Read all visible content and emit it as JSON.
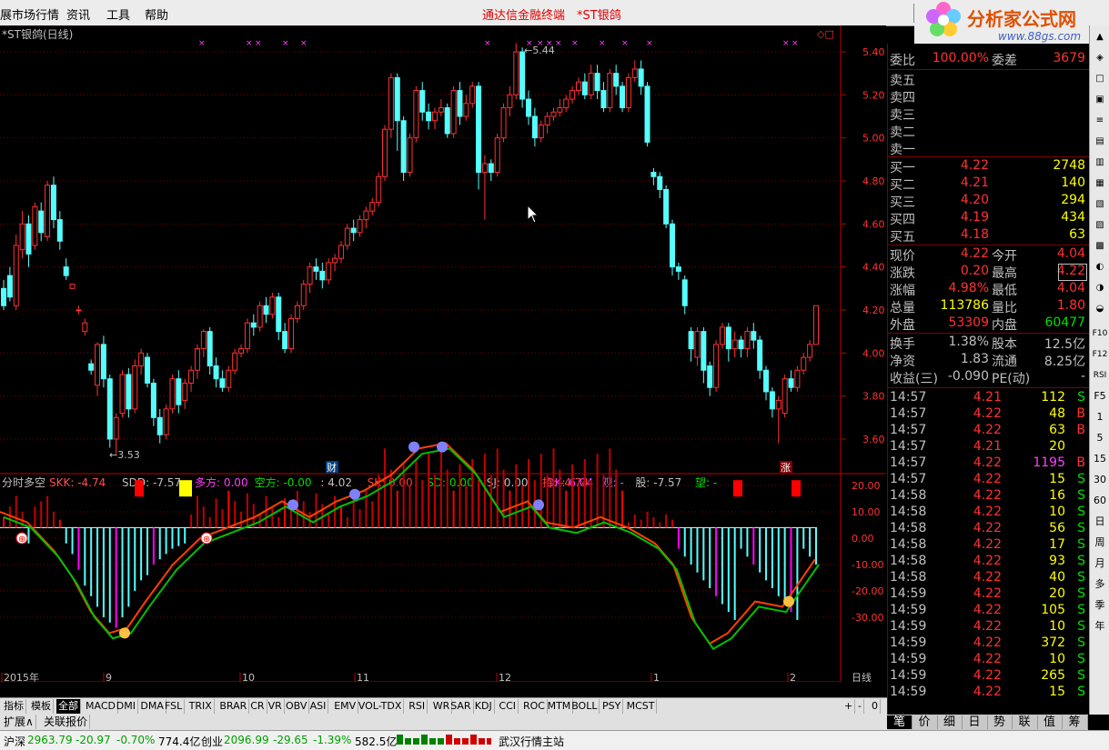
{
  "menu": {
    "items": [
      "展市场行情",
      "资讯",
      "工具",
      "帮助"
    ],
    "title": "通达信金融终端　*ST银鸽",
    "right_btn": "行"
  },
  "logo": {
    "text": "分析家公式网",
    "url": "www.88gs.com"
  },
  "chart": {
    "title": "*ST银鸽(日线)",
    "price_ticks": [
      "5.40",
      "5.20",
      "5.00",
      "4.80",
      "4.60",
      "4.40",
      "4.20",
      "4.00",
      "3.80",
      "3.60"
    ],
    "high_label": "5.44",
    "low_label": "3.53",
    "cai": "财",
    "zhang": "涨",
    "period": "日线",
    "months": [
      "2015年",
      "9",
      "10",
      "11",
      "12",
      "1",
      "2"
    ]
  },
  "indicator": {
    "name": "分时多空",
    "items": [
      {
        "label": "SKK: -4.74",
        "color": "#ff5050"
      },
      {
        "label": "SDD: -7.57",
        "color": "#c0c0c0"
      },
      {
        "label": "多方: 0.00",
        "color": "#ff40ff"
      },
      {
        "label": "空方: -0.00",
        "color": "#00e000"
      },
      {
        "label": ": 4.02",
        "color": "#c0c0c0"
      },
      {
        "label": "SK: 0.00",
        "color": "#ff4040"
      },
      {
        "label": "SD: 0.00",
        "color": "#00e000"
      },
      {
        "label": "SJ: 0.00",
        "color": "#c0c0c0"
      },
      {
        "label": "DK: 6.04",
        "color": "#ff40ff"
      },
      {
        "label": "持: -4.74",
        "color": "#ff4040"
      },
      {
        "label": "观: -",
        "color": "#8080ff"
      },
      {
        "label": "股: -7.57",
        "color": "#c0c0c0"
      },
      {
        "label": "望: -",
        "color": "#00e000"
      }
    ],
    "ticks": [
      "20.00",
      "10.00",
      "0.00",
      "-10.00",
      "-20.00",
      "-30.00"
    ]
  },
  "tabs": [
    "指标",
    "模板",
    "全部",
    "MACD",
    "DMI",
    "DMA",
    "FSL",
    "TRIX",
    "BRAR",
    "CR",
    "VR",
    "OBV",
    "ASI",
    "EMV",
    "VOL-TDX",
    "RSI",
    "WR",
    "SAR",
    "KDJ",
    "CCI",
    "ROC",
    "MTM",
    "BOLL",
    "PSY",
    "MCST"
  ],
  "tab_ctrl": [
    "+",
    "-",
    "0"
  ],
  "extend": [
    "扩展∧",
    "关联报价"
  ],
  "quote": {
    "weibi": {
      "label": "委比",
      "value": "100.00%",
      "label2": "委差",
      "value2": "3679"
    },
    "sell": [
      {
        "name": "卖五"
      },
      {
        "name": "卖四"
      },
      {
        "name": "卖三"
      },
      {
        "name": "卖二"
      },
      {
        "name": "卖一"
      }
    ],
    "buy": [
      {
        "name": "买一",
        "price": "4.22",
        "vol": "2748"
      },
      {
        "name": "买二",
        "price": "4.21",
        "vol": "140"
      },
      {
        "name": "买三",
        "price": "4.20",
        "vol": "294"
      },
      {
        "name": "买四",
        "price": "4.19",
        "vol": "434"
      },
      {
        "name": "买五",
        "price": "4.18",
        "vol": "63"
      }
    ],
    "stats": [
      {
        "l1": "现价",
        "v1": "4.22",
        "l2": "今开",
        "v2": "4.04"
      },
      {
        "l1": "涨跌",
        "v1": "0.20",
        "l2": "最高",
        "v2": "4.22"
      },
      {
        "l1": "涨幅",
        "v1": "4.98%",
        "l2": "最低",
        "v2": "4.04"
      },
      {
        "l1": "总量",
        "v1": "113786",
        "l2": "量比",
        "v2": "1.80"
      },
      {
        "l1": "外盘",
        "v1": "53309",
        "l2": "内盘",
        "v2": "60477"
      }
    ],
    "stats2": [
      {
        "l1": "换手",
        "v1": "1.38%",
        "l2": "股本",
        "v2": "12.5亿"
      },
      {
        "l1": "净资",
        "v1": "1.83",
        "l2": "流通",
        "v2": "8.25亿"
      },
      {
        "l1": "收益(三)",
        "v1": "-0.090",
        "l2": "PE(动)",
        "v2": "-"
      }
    ],
    "ticks": [
      {
        "t": "14:57",
        "p": "4.21",
        "v": "112",
        "s": "S"
      },
      {
        "t": "14:57",
        "p": "4.22",
        "v": "48",
        "s": "B"
      },
      {
        "t": "14:57",
        "p": "4.22",
        "v": "63",
        "s": "B"
      },
      {
        "t": "14:57",
        "p": "4.21",
        "v": "20",
        "s": ""
      },
      {
        "t": "14:57",
        "p": "4.22",
        "v": "1195",
        "s": "B"
      },
      {
        "t": "14:57",
        "p": "4.22",
        "v": "15",
        "s": "S"
      },
      {
        "t": "14:58",
        "p": "4.22",
        "v": "16",
        "s": "S"
      },
      {
        "t": "14:58",
        "p": "4.22",
        "v": "10",
        "s": "S"
      },
      {
        "t": "14:58",
        "p": "4.22",
        "v": "56",
        "s": "S"
      },
      {
        "t": "14:58",
        "p": "4.22",
        "v": "17",
        "s": "S"
      },
      {
        "t": "14:58",
        "p": "4.22",
        "v": "93",
        "s": "S"
      },
      {
        "t": "14:58",
        "p": "4.22",
        "v": "40",
        "s": "S"
      },
      {
        "t": "14:59",
        "p": "4.22",
        "v": "20",
        "s": "S"
      },
      {
        "t": "14:59",
        "p": "4.22",
        "v": "105",
        "s": "S"
      },
      {
        "t": "14:59",
        "p": "4.22",
        "v": "10",
        "s": "S"
      },
      {
        "t": "14:59",
        "p": "4.22",
        "v": "372",
        "s": "S"
      },
      {
        "t": "14:59",
        "p": "4.22",
        "v": "10",
        "s": "S"
      },
      {
        "t": "14:59",
        "p": "4.22",
        "v": "265",
        "s": "S"
      },
      {
        "t": "14:59",
        "p": "4.22",
        "v": "15",
        "s": "S"
      }
    ],
    "tabs": [
      "笔",
      "价",
      "细",
      "日",
      "势",
      "联",
      "值",
      "筹"
    ]
  },
  "toolstrip": [
    "F10",
    "F12",
    "RSI",
    "F5",
    "1",
    "5",
    "15",
    "30",
    "60",
    "日",
    "周",
    "月",
    "多",
    "季",
    "年"
  ],
  "status": {
    "sh_label": "沪深",
    "sh_value": "2963.79",
    "sh_chg": "-20.97",
    "sh_pct": "-0.70%",
    "sh_amt": "774.4亿",
    "cy_label": "创业",
    "cy_value": "2096.99",
    "cy_chg": "-29.65",
    "cy_pct": "-1.39%",
    "cy_amt": "582.5亿",
    "station": "武汉行情主站"
  },
  "colors": {
    "up": "#ff3232",
    "down": "#54ffff",
    "yellow": "#ffff00",
    "green": "#00e000",
    "magenta": "#ff40ff"
  }
}
